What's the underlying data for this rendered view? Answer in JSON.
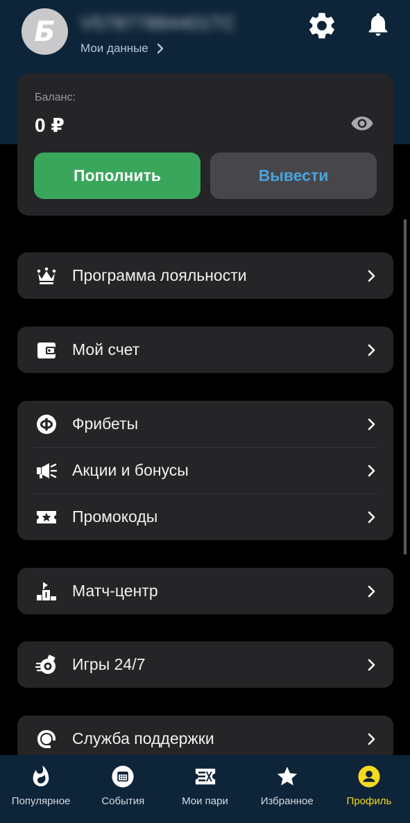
{
  "header": {
    "avatar_letter": "Б",
    "user_id": "V57877884401TC",
    "my_data_label": "Мои данные"
  },
  "balance": {
    "label": "Баланс:",
    "value": "0 ₽",
    "deposit_label": "Пополнить",
    "withdraw_label": "Вывести"
  },
  "menu": {
    "loyalty": "Программа лояльности",
    "account": "Мой счет",
    "freebets": "Фрибеты",
    "promotions": "Акции и бонусы",
    "promocodes": "Промокоды",
    "match_center": "Матч-центр",
    "games": "Игры 24/7",
    "support": "Служба поддержки"
  },
  "tabbar": {
    "popular": "Популярное",
    "events": "События",
    "my_bets": "Мои пари",
    "favorites": "Избранное",
    "profile": "Профиль",
    "active_tab": "profile"
  },
  "colors": {
    "header_bg": "#0e2438",
    "card_bg": "#252527",
    "deposit_green": "#3aa65c",
    "withdraw_text_blue": "#4aa3dc",
    "active_tab_yellow": "#f5d921"
  }
}
